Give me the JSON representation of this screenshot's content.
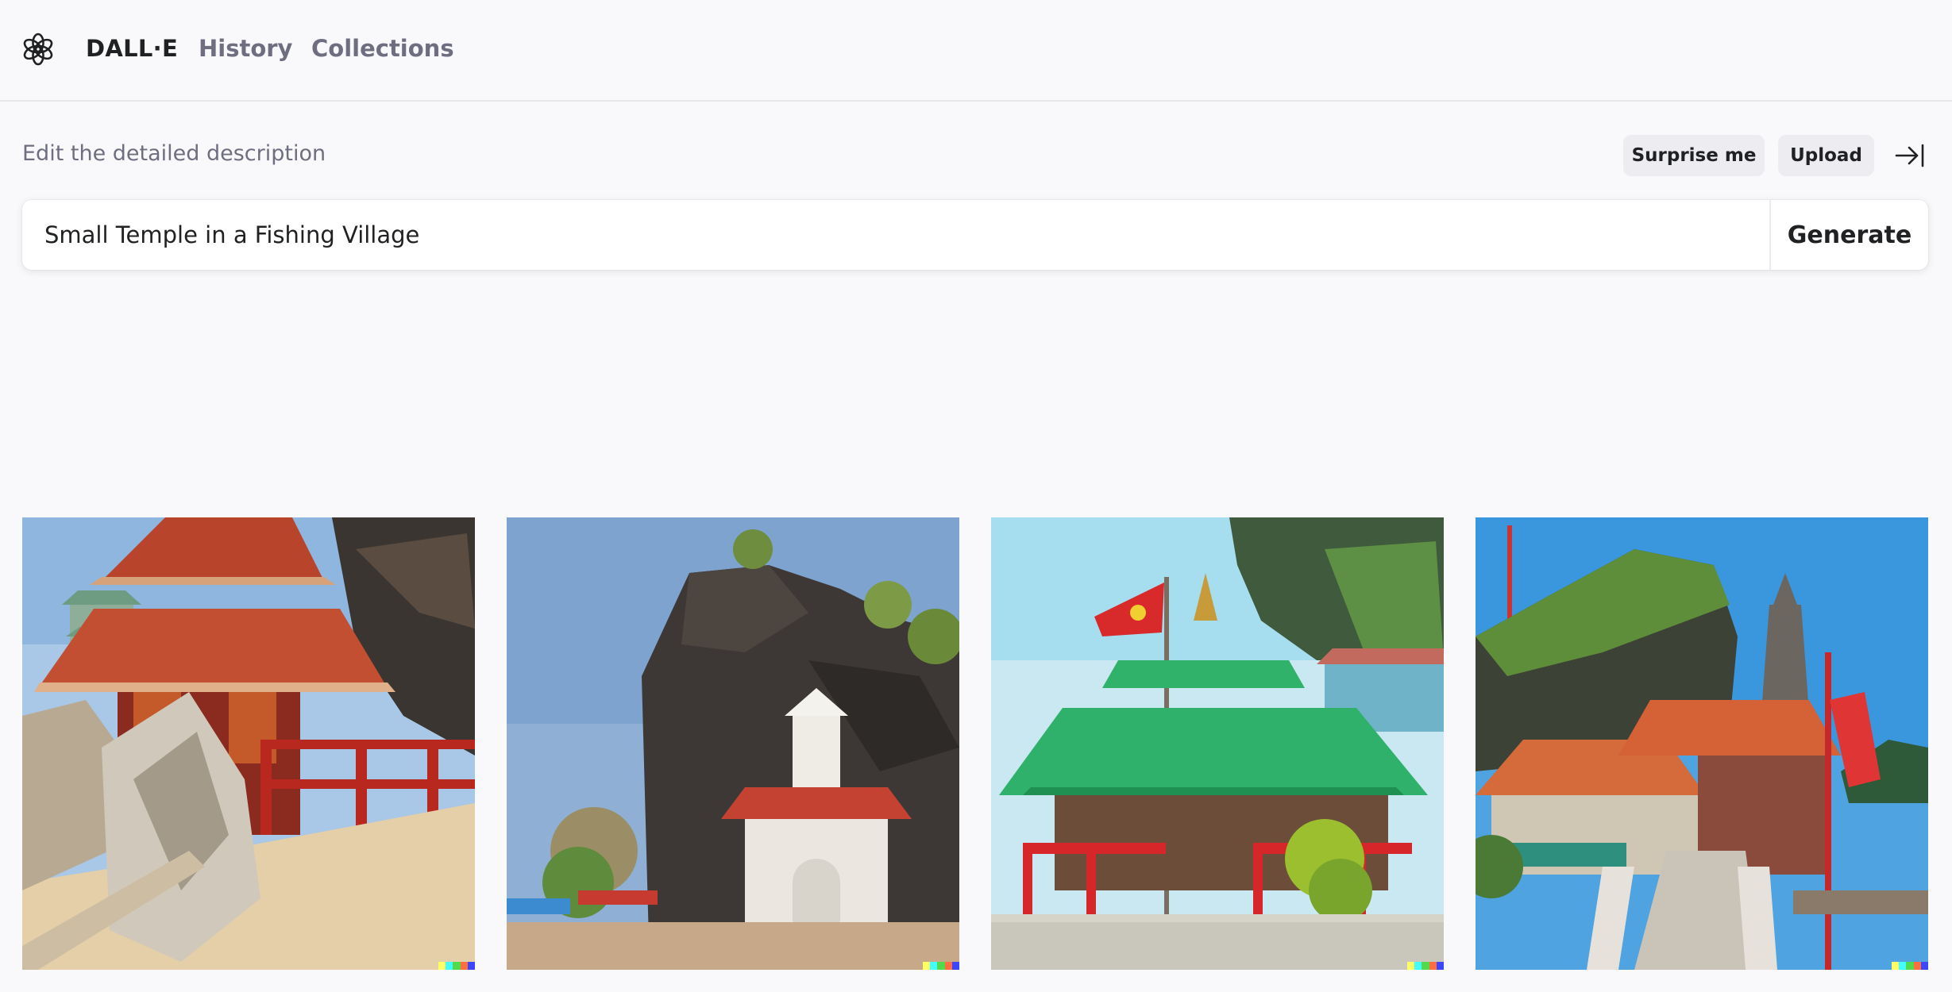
{
  "nav": {
    "brand": "DALL·E",
    "history": "History",
    "collections": "Collections"
  },
  "prompt": {
    "label": "Edit the detailed description",
    "surprise_label": "Surprise me",
    "upload_label": "Upload",
    "value": "Small Temple in a Fishing Village",
    "generate_label": "Generate"
  },
  "icons": {
    "logo": "openai-logo-icon",
    "collapse": "collapse-right-icon"
  },
  "colors": {
    "background": "#f9f9fb",
    "pill": "#ececf1",
    "muted_text": "#6e6e80",
    "text": "#202123",
    "signature": [
      "#ffff66",
      "#42ffff",
      "#51da4c",
      "#ff6e3c",
      "#3c46ff"
    ]
  },
  "results": [
    {
      "scene": "red-roof-temple-on-rocks"
    },
    {
      "scene": "white-shrine-below-cliff"
    },
    {
      "scene": "green-roof-temple-with-flag"
    },
    {
      "scene": "orange-roof-temple-on-island"
    }
  ]
}
